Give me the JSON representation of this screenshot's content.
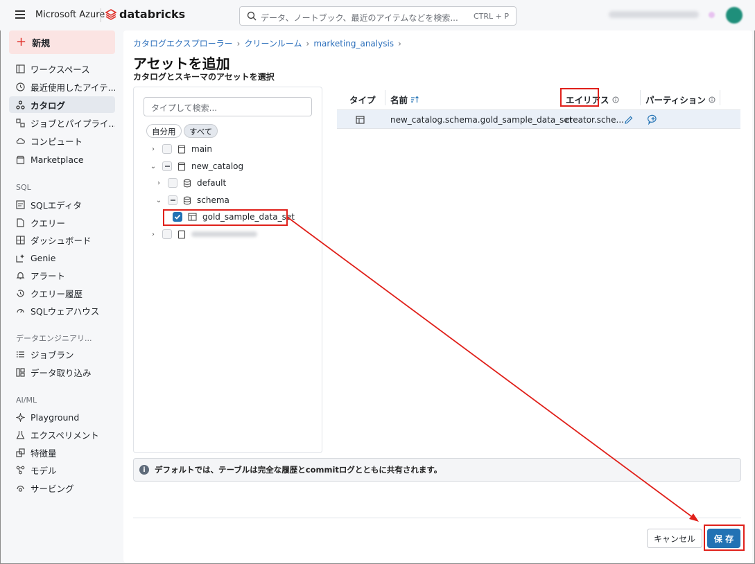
{
  "topbar": {
    "brand_ms": "Microsoft Azure",
    "brand_db": "databricks",
    "search_placeholder": "データ、ノートブック、最近のアイテムなどを検索...",
    "search_shortcut": "CTRL + P"
  },
  "sidebar": {
    "new_label": "新規",
    "items": [
      {
        "label": "ワークスペース",
        "icon": "workspace-icon"
      },
      {
        "label": "最近使用したアイテ...",
        "icon": "clock-icon"
      },
      {
        "label": "カタログ",
        "icon": "catalog-icon",
        "active": true
      },
      {
        "label": "ジョブとパイプライ...",
        "icon": "jobs-icon"
      },
      {
        "label": "コンピュート",
        "icon": "cloud-icon"
      },
      {
        "label": "Marketplace",
        "icon": "store-icon"
      }
    ],
    "section_sql": "SQL",
    "sql_items": [
      {
        "label": "SQLエディタ",
        "icon": "editor-icon"
      },
      {
        "label": "クエリー",
        "icon": "query-icon"
      },
      {
        "label": "ダッシュボード",
        "icon": "dashboard-icon"
      },
      {
        "label": "Genie",
        "icon": "genie-icon"
      },
      {
        "label": "アラート",
        "icon": "bell-icon"
      },
      {
        "label": "クエリー履歴",
        "icon": "history-icon"
      },
      {
        "label": "SQLウェアハウス",
        "icon": "warehouse-icon"
      }
    ],
    "section_de": "データエンジニアリ...",
    "de_items": [
      {
        "label": "ジョブラン",
        "icon": "job-runs-icon"
      },
      {
        "label": "データ取り込み",
        "icon": "ingest-icon"
      }
    ],
    "section_ai": "AI/ML",
    "ai_items": [
      {
        "label": "Playground",
        "icon": "sparkle-icon"
      },
      {
        "label": "エクスペリメント",
        "icon": "flask-icon"
      },
      {
        "label": "特徴量",
        "icon": "features-icon"
      },
      {
        "label": "モデル",
        "icon": "model-icon"
      },
      {
        "label": "サービング",
        "icon": "serving-icon"
      }
    ]
  },
  "breadcrumb": [
    "カタログエクスプローラー",
    "クリーンルーム",
    "marketing_analysis"
  ],
  "page_title": "アセットを追加",
  "subtitle": "カタログとスキーマのアセットを選択",
  "tree": {
    "search_placeholder": "タイプして検索...",
    "filter_mine": "自分用",
    "filter_all": "すべて",
    "nodes": [
      {
        "label": "main",
        "level": 0,
        "expanded": false,
        "check": "none",
        "type": "catalog"
      },
      {
        "label": "new_catalog",
        "level": 0,
        "expanded": true,
        "check": "indeterminate",
        "type": "catalog"
      },
      {
        "label": "default",
        "level": 1,
        "expanded": false,
        "check": "none",
        "type": "schema"
      },
      {
        "label": "schema",
        "level": 1,
        "expanded": true,
        "check": "indeterminate",
        "type": "schema"
      },
      {
        "label": "gold_sample_data_set",
        "level": 2,
        "check": "checked",
        "type": "table"
      },
      {
        "label": "",
        "level": 0,
        "expanded": false,
        "check": "none",
        "type": "catalog",
        "blurred": true
      }
    ]
  },
  "table": {
    "headers": {
      "type": "タイプ",
      "name": "名前",
      "alias": "エイリアス",
      "partition": "パーティション"
    },
    "rows": [
      {
        "name": "new_catalog.schema.gold_sample_data_set",
        "alias": "creator.sche..."
      }
    ]
  },
  "info_text": "デフォルトでは、テーブルは完全な履歴とcommitログとともに共有されます。",
  "buttons": {
    "cancel": "キャンセル",
    "save": "保 存"
  },
  "colors": {
    "primary": "#2272b4",
    "annotation": "#e0201a",
    "brand": "#e0322b"
  }
}
